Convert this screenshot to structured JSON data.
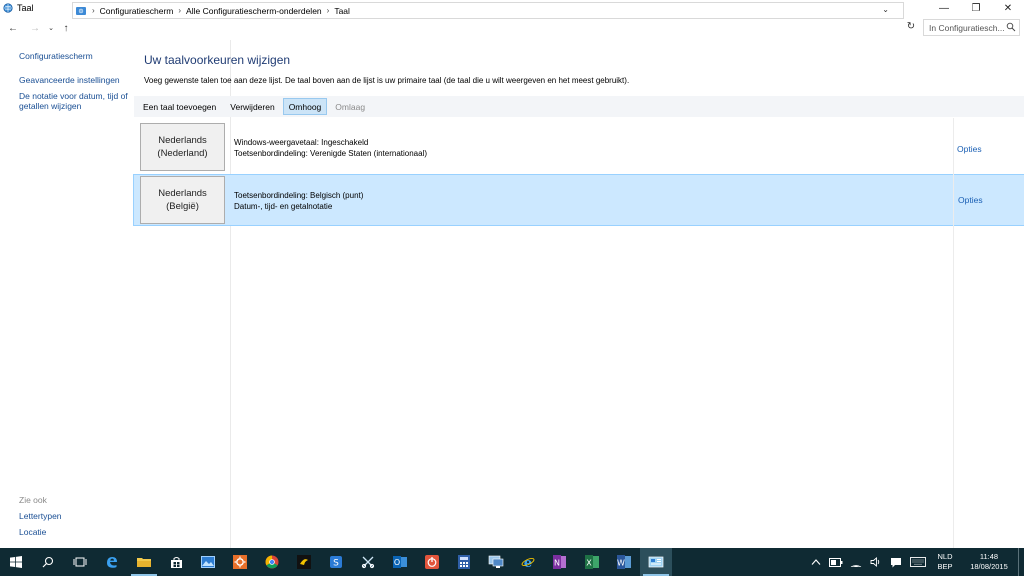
{
  "window": {
    "title": "Taal",
    "controls": {
      "minimize": "—",
      "maximize": "❐",
      "close": "✕"
    }
  },
  "address": {
    "breadcrumbs": [
      "Configuratiescherm",
      "Alle Configuratiescherm-onderdelen",
      "Taal"
    ],
    "search_placeholder": "In Configuratiesch..."
  },
  "sidebar": {
    "links": [
      "Configuratiescherm",
      "Geavanceerde instellingen",
      "De notatie voor datum, tijd of getallen wijzigen"
    ],
    "see_also_title": "Zie ook",
    "see_also": [
      "Lettertypen",
      "Locatie"
    ]
  },
  "main": {
    "title": "Uw taalvoorkeuren wijzigen",
    "description": "Voeg gewenste talen toe aan deze lijst. De taal boven aan de lijst is uw primaire taal (de taal die u wilt weergeven en het meest gebruikt).",
    "toolbar": {
      "add": "Een taal toevoegen",
      "remove": "Verwijderen",
      "up": "Omhoog",
      "down": "Omlaag"
    },
    "languages": [
      {
        "name_line1": "Nederlands",
        "name_line2": "(Nederland)",
        "info_line1": "Windows-weergavetaal: Ingeschakeld",
        "info_line2": "Toetsenbordindeling: Verenigde Staten (internationaal)",
        "options": "Opties"
      },
      {
        "name_line1": "Nederlands",
        "name_line2": "(België)",
        "info_line1": "Toetsenbordindeling: Belgisch (punt)",
        "info_line2": "Datum-, tijd- en getalnotatie",
        "options": "Opties"
      }
    ]
  },
  "taskbar": {
    "input_lang_1": "NLD",
    "input_lang_2": "BEP",
    "time": "11:48",
    "date": "18/08/2015"
  },
  "colors": {
    "taskbar": "#0f2a33",
    "link": "#1a4f94",
    "title": "#1f3b73",
    "selection": "#cce8ff"
  }
}
